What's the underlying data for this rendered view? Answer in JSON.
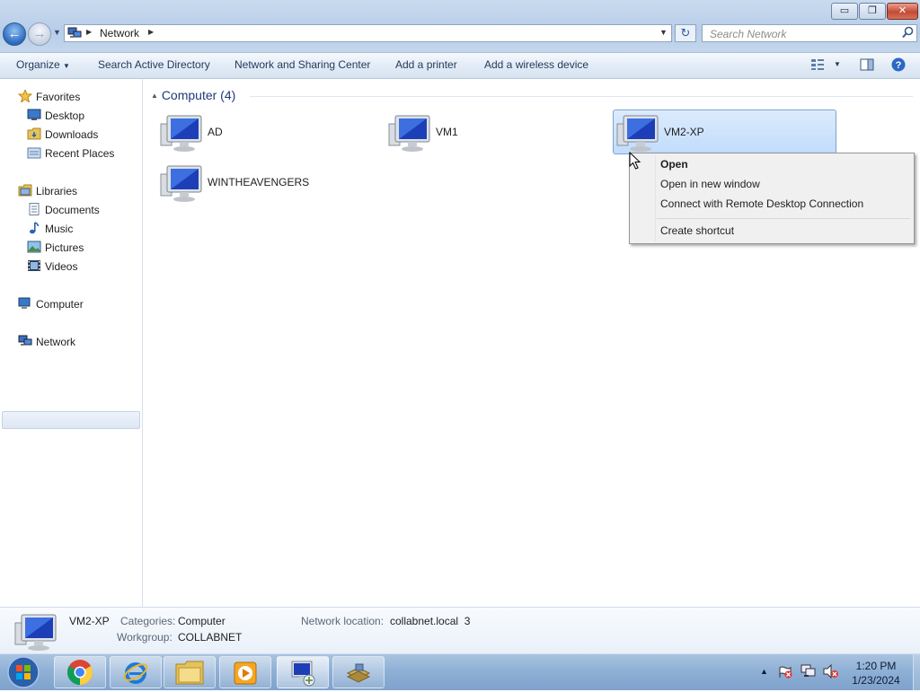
{
  "window": {
    "caption_minimize": "▭",
    "caption_maximize": "❐",
    "caption_close": "✕"
  },
  "address": {
    "breadcrumb": [
      "Network"
    ],
    "search_placeholder": "Search Network"
  },
  "toolbar": {
    "organize": "Organize",
    "search_ad": "Search Active Directory",
    "network_sharing": "Network and Sharing Center",
    "add_printer": "Add a printer",
    "add_wireless": "Add a wireless device"
  },
  "nav": {
    "favorites": "Favorites",
    "desktop": "Desktop",
    "downloads": "Downloads",
    "recent": "Recent Places",
    "libraries": "Libraries",
    "documents": "Documents",
    "music": "Music",
    "pictures": "Pictures",
    "videos": "Videos",
    "computer": "Computer",
    "network": "Network"
  },
  "content": {
    "group_title": "Computer (4)",
    "computers": [
      "AD",
      "VM1",
      "VM2-XP",
      "WINTHEAVENGERS"
    ],
    "selected": "VM2-XP"
  },
  "context_menu": {
    "open": "Open",
    "open_new_window": "Open in new window",
    "connect_rdp": "Connect with Remote Desktop Connection",
    "create_shortcut": "Create shortcut"
  },
  "details": {
    "name": "VM2-XP",
    "categories_label": "Categories:",
    "categories_value": "Computer",
    "workgroup_label": "Workgroup:",
    "workgroup_value": "COLLABNET",
    "location_label": "Network location:",
    "location_value": "collabnet.local  3"
  },
  "taskbar": {
    "time": "1:20 PM",
    "date": "1/23/2024"
  },
  "colors": {
    "accent": "#1e3a78",
    "selection": "#c1dcfc"
  }
}
